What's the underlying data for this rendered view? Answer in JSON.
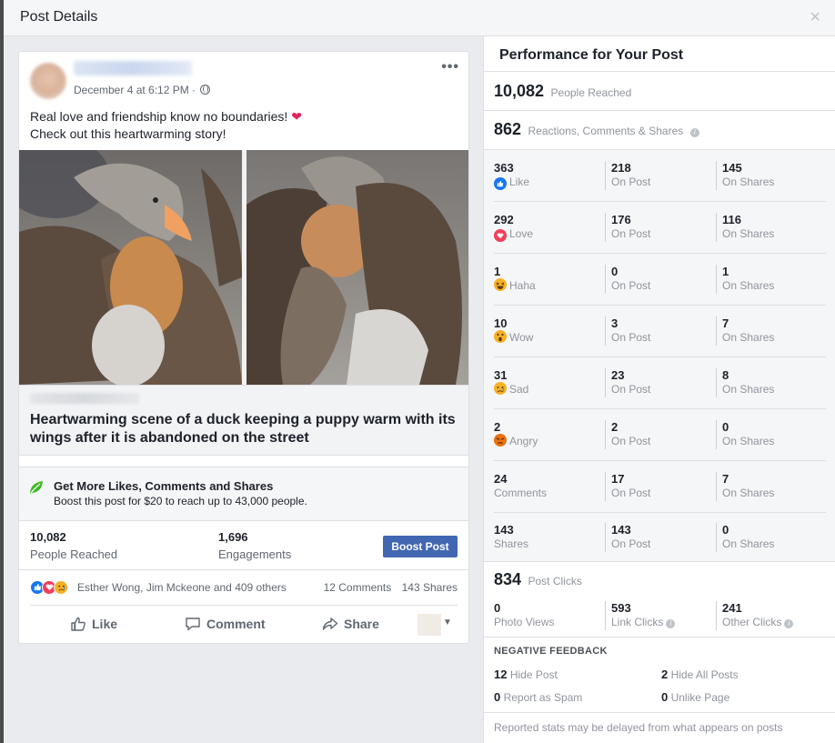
{
  "dialog": {
    "title": "Post Details",
    "close_label": "×"
  },
  "post": {
    "timestamp": "December 4 at 6:12 PM ·",
    "more_label": "•••",
    "text_line1": "Real love and friendship know no boundaries!",
    "text_emoji": "❤",
    "text_line2": "Check out this heartwarming story!",
    "link_title": "Heartwarming scene of a duck keeping a puppy warm with its wings after it is abandoned on the street",
    "boost_title": "Get More Likes, Comments and Shares",
    "boost_subtitle": "Boost this post for $20 to reach up to 43,000 people.",
    "reached_num": "10,082",
    "reached_label": "People Reached",
    "engagements_num": "1,696",
    "engagements_label": "Engagements",
    "boost_button": "Boost Post",
    "reactors": "Esther Wong, Jim Mckeone and 409 others",
    "comments_count": "12 Comments",
    "shares_count": "143 Shares",
    "actions": {
      "like": "Like",
      "comment": "Comment",
      "share": "Share"
    }
  },
  "performance": {
    "title": "Performance for Your Post",
    "reached_num": "10,082",
    "reached_label": "People Reached",
    "rcs_num": "862",
    "rcs_label": "Reactions, Comments & Shares",
    "rows": [
      {
        "total": "363",
        "label": "Like",
        "emoji": "like-icon",
        "post": "218",
        "shares": "145"
      },
      {
        "total": "292",
        "label": "Love",
        "emoji": "love-icon",
        "post": "176",
        "shares": "116"
      },
      {
        "total": "1",
        "label": "Haha",
        "emoji": "haha-icon",
        "post": "0",
        "shares": "1"
      },
      {
        "total": "10",
        "label": "Wow",
        "emoji": "wow-icon",
        "post": "3",
        "shares": "7"
      },
      {
        "total": "31",
        "label": "Sad",
        "emoji": "sad-icon",
        "post": "23",
        "shares": "8"
      },
      {
        "total": "2",
        "label": "Angry",
        "emoji": "angry-icon",
        "post": "2",
        "shares": "0"
      },
      {
        "total": "24",
        "label": "Comments",
        "emoji": "",
        "post": "17",
        "shares": "7"
      },
      {
        "total": "143",
        "label": "Shares",
        "emoji": "",
        "post": "143",
        "shares": "0"
      }
    ],
    "on_post_label": "On Post",
    "on_shares_label": "On Shares",
    "clicks_num": "834",
    "clicks_label": "Post Clicks",
    "photo_views_num": "0",
    "photo_views_label": "Photo Views",
    "link_clicks_num": "593",
    "link_clicks_label": "Link Clicks",
    "other_clicks_num": "241",
    "other_clicks_label": "Other Clicks",
    "negative_title": "NEGATIVE FEEDBACK",
    "hide_post_num": "12",
    "hide_post_label": "Hide Post",
    "hide_all_num": "2",
    "hide_all_label": "Hide All Posts",
    "spam_num": "0",
    "spam_label": "Report as Spam",
    "unlike_num": "0",
    "unlike_label": "Unlike Page",
    "footer": "Reported stats may be delayed from what appears on posts"
  },
  "colors": {
    "brand": "#4267b2",
    "like": "#1877f2",
    "love": "#f33e58",
    "reaction_yellow": "#f7b125",
    "angry": "#e9710f"
  }
}
